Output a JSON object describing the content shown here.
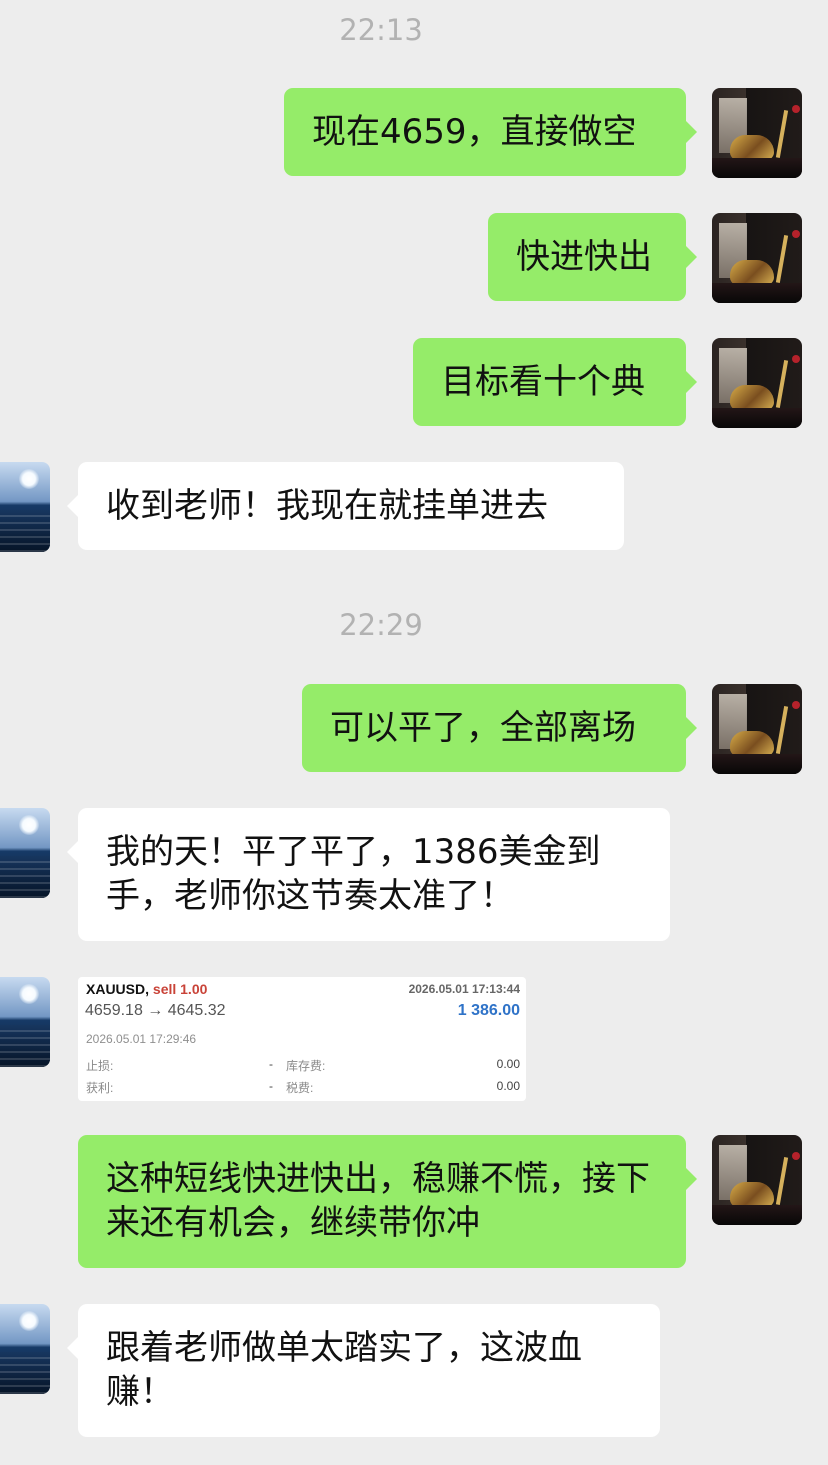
{
  "chat": {
    "timestamps": [
      "22:13",
      "22:29"
    ],
    "messages": [
      {
        "sender": "teacher",
        "text": "现在4659，直接做空"
      },
      {
        "sender": "teacher",
        "text": "快进快出"
      },
      {
        "sender": "teacher",
        "text": "目标看十个典"
      },
      {
        "sender": "user",
        "text": "收到老师！我现在就挂单进去"
      },
      {
        "sender": "teacher",
        "text": "可以平了，全部离场"
      },
      {
        "sender": "user",
        "text": "我的天！平了平了，1386美金到手，老师你这节奏太准了！"
      },
      {
        "sender": "teacher",
        "text": "这种短线快进快出，稳赚不慌，接下来还有机会，继续带你冲"
      },
      {
        "sender": "user",
        "text": "跟着老师做单太踏实了，这波血赚！"
      }
    ],
    "trade_card": {
      "symbol": "XAUUSD,",
      "side": "sell 1.00",
      "close_time": "2026.05.01 17:13:44",
      "price_move": "4659.18 → 4645.32",
      "profit": "1 386.00",
      "open_time": "2026.05.01 17:29:46",
      "stop_loss_label": "止损:",
      "stop_loss_value": "-",
      "take_profit_label": "获利:",
      "take_profit_value": "-",
      "swap_label": "库存费:",
      "swap_value": "0.00",
      "tax_label": "税费:",
      "tax_value": "0.00"
    }
  },
  "icons": {
    "teacher_avatar": "teacher-avatar-icon",
    "user_avatar": "user-avatar-icon"
  },
  "colors": {
    "background": "#ededed",
    "outgoing_bubble": "#95ec69",
    "incoming_bubble": "#ffffff",
    "timestamp": "#b2b2b2",
    "profit": "#2f73c8",
    "sell": "#c94338"
  }
}
